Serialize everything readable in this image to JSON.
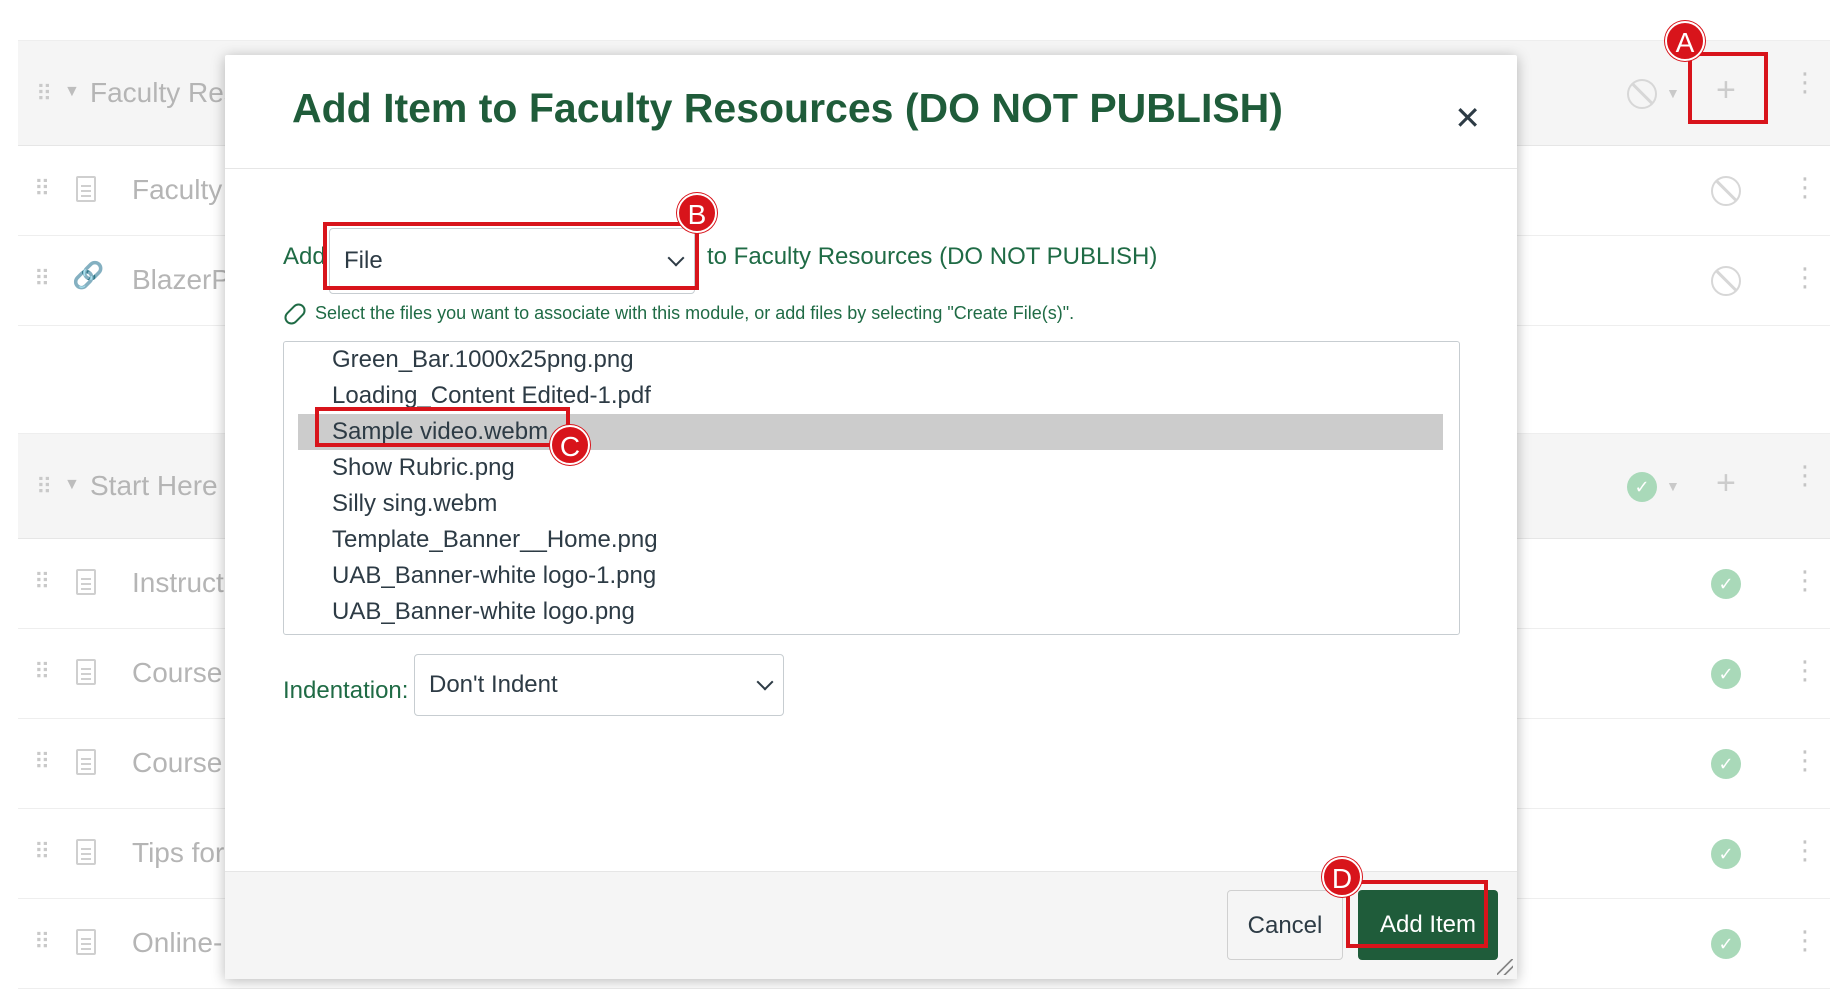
{
  "background": {
    "modules": [
      {
        "title": "Faculty Res",
        "items": [
          {
            "label": "Faculty",
            "type": "page"
          },
          {
            "label": "BlazerP",
            "type": "link"
          }
        ]
      },
      {
        "title": "Start Here",
        "items": [
          {
            "label": "Instruct",
            "type": "page"
          },
          {
            "label": "Course",
            "type": "page"
          },
          {
            "label": "Course",
            "type": "page"
          },
          {
            "label": "Tips for",
            "type": "page"
          },
          {
            "label": "Online-",
            "type": "page"
          }
        ]
      }
    ],
    "icons": {
      "unpublished": "ban-icon",
      "published": "check-circle-icon",
      "add": "plus-icon",
      "more": "kebab-icon",
      "drag": "drag-handle-icon"
    }
  },
  "dialog": {
    "title": "Add Item to Faculty Resources (DO NOT PUBLISH)",
    "close_glyph": "✕",
    "add_prefix": "Add",
    "item_type": "File",
    "to_suffix": "to Faculty Resources (DO NOT PUBLISH)",
    "hint": "Select the files you want to associate with this module, or add files by selecting \"Create File(s)\".",
    "files": [
      "Green_Bar.1000x25png.png",
      "Loading_Content Edited-1.pdf",
      "Sample video.webm",
      "Show Rubric.png",
      "Silly sing.webm",
      "Template_Banner__Home.png",
      "UAB_Banner-white logo-1.png",
      "UAB_Banner-white logo.png"
    ],
    "selected_file": "Sample video.webm",
    "indentation_label": "Indentation:",
    "indentation_value": "Don't Indent",
    "cancel_label": "Cancel",
    "add_item_label": "Add Item"
  },
  "callouts": [
    "A",
    "B",
    "C",
    "D"
  ],
  "colors": {
    "brand_green": "#1f5c3a",
    "text_green": "#1f6b45",
    "callout_red": "#d8141b",
    "selected_row": "#cccccc"
  }
}
